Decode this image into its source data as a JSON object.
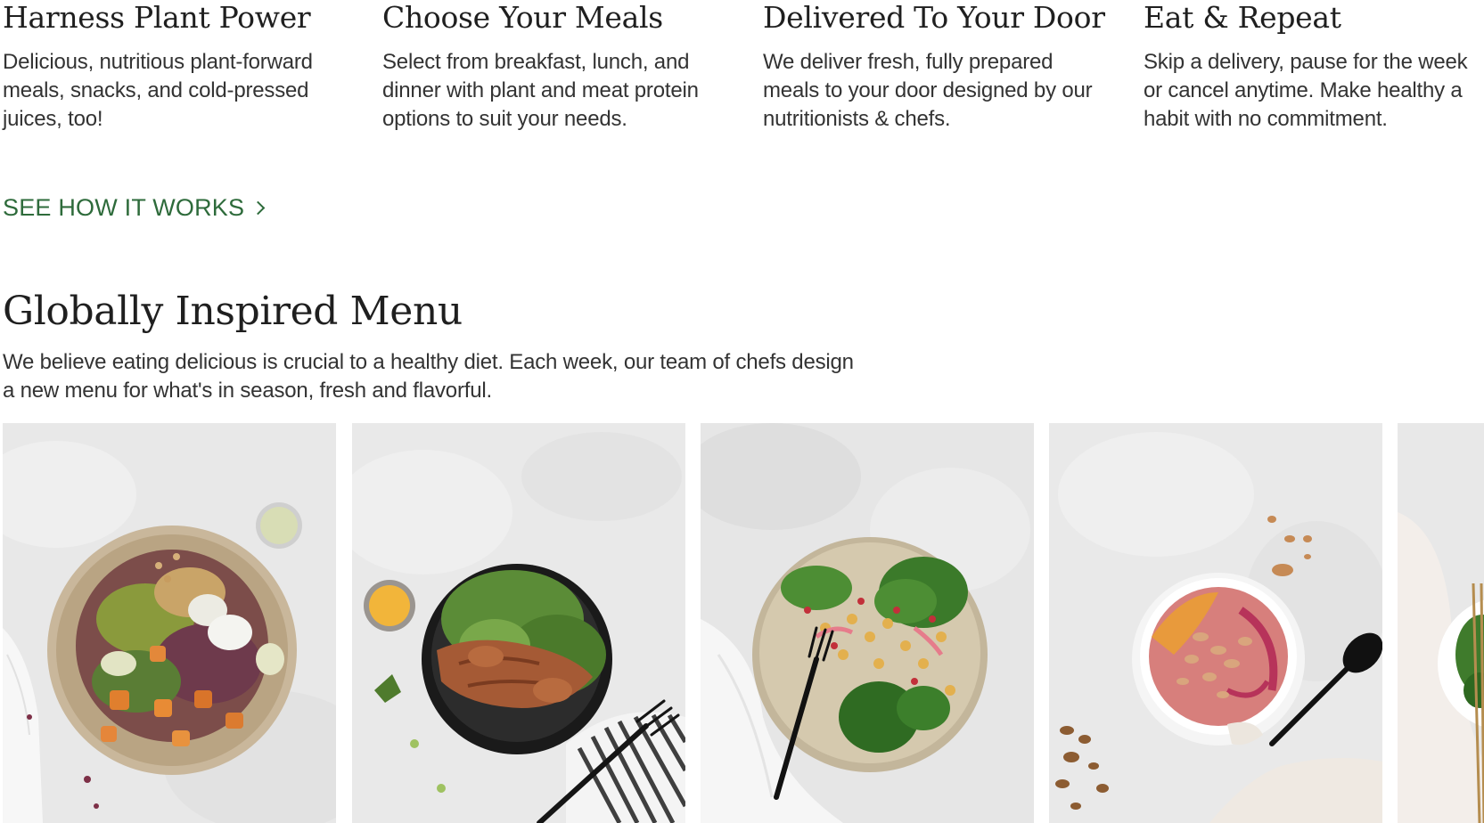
{
  "steps": [
    {
      "title": "Harness Plant Power",
      "description": "Delicious, nutritious plant-forward meals, snacks, and cold-pressed juices, too!"
    },
    {
      "title": "Choose Your Meals",
      "description": "Select from breakfast, lunch, and dinner with plant and meat protein options to suit your needs."
    },
    {
      "title": "Delivered To Your Door",
      "description": "We deliver fresh, fully prepared meals to your door designed by our nutritionists & chefs."
    },
    {
      "title": "Eat & Repeat",
      "description": "Skip a delivery, pause for the week or cancel anytime. Make healthy a habit with no commitment."
    }
  ],
  "link": {
    "label": "SEE HOW IT WORKS"
  },
  "menu": {
    "title": "Globally Inspired Menu",
    "description": "We believe eating delicious is crucial to a healthy diet. Each week, our team of chefs design a new menu for what's in season, fresh and flavorful."
  },
  "colors": {
    "link_green": "#2e6b3b",
    "text_dark": "#1f1f1f",
    "background": "#ffffff"
  },
  "icons": {
    "link_chevron": "chevron-right-icon"
  }
}
